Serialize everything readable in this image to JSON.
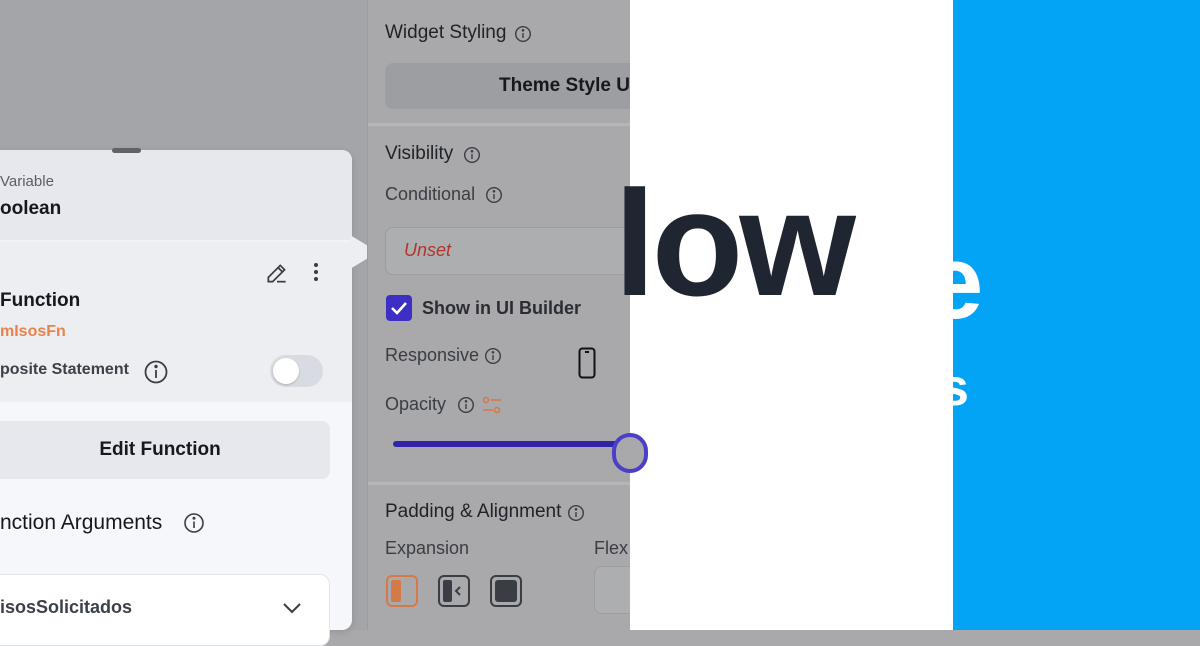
{
  "popover": {
    "variable_label": "Variable",
    "variable_type": "oolean",
    "function_label": "Function",
    "function_name": "mIsosFn",
    "composite_label": "posite Statement",
    "composite_enabled": false,
    "edit_button": "Edit Function",
    "arguments_title": "nction Arguments",
    "argument_value": "isosSolicitados"
  },
  "panel": {
    "widget_styling_title": "Widget Styling",
    "theme_button": "Theme Style U",
    "visibility_title": "Visibility",
    "conditional_label": "Conditional",
    "conditional_value": "Unset",
    "show_in_ui_builder": "Show in UI Builder",
    "show_in_ui_builder_checked": true,
    "responsive_label": "Responsive",
    "opacity_label": "Opacity",
    "opacity_value": 1.0,
    "padding_title": "Padding & Alignment",
    "expansion_label": "Expansion",
    "flex_label": "Flex"
  },
  "logo": {
    "white_text": "low",
    "blue_text_1": "e",
    "blue_text_2": "s"
  },
  "colors": {
    "accent": "#3d2fc4",
    "function_orange": "#e8834e",
    "unset_red": "#b3342c",
    "logo_dark": "#1f2631",
    "brand_blue": "#03a3f5"
  }
}
